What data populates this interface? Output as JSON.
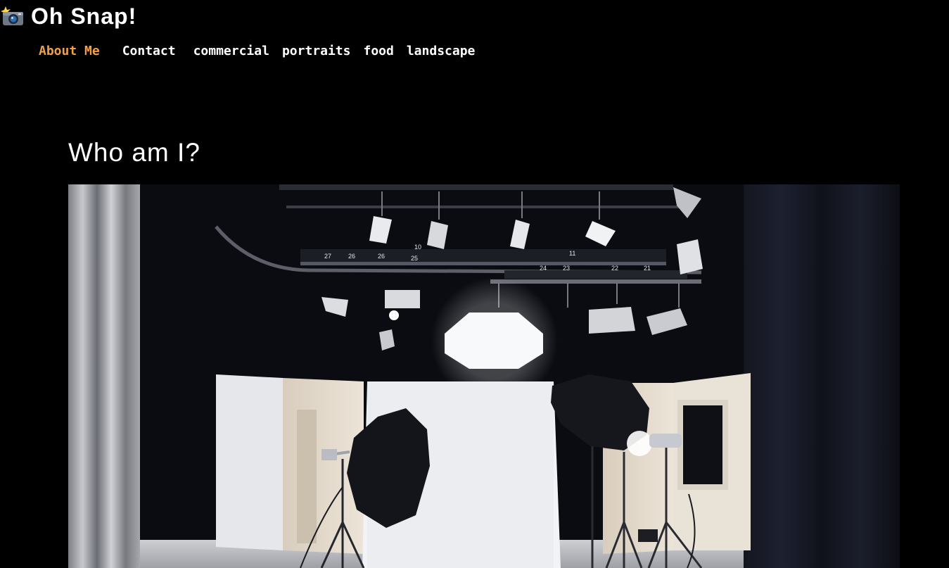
{
  "header": {
    "title": "Oh Snap!",
    "logo_icon": "camera-flash-icon"
  },
  "nav": {
    "items": [
      {
        "label": "About Me",
        "active": true
      },
      {
        "label": "Contact",
        "active": false
      },
      {
        "label": "commercial",
        "active": false
      },
      {
        "label": "portraits",
        "active": false
      },
      {
        "label": "food",
        "active": false
      },
      {
        "label": "landscape",
        "active": false
      }
    ]
  },
  "main": {
    "heading": "Who am I?",
    "hero_image": {
      "subject": "photo-studio-image",
      "rig_labels": [
        "27",
        "26",
        "26",
        "25",
        "10",
        "11",
        "24",
        "23",
        "22",
        "21"
      ]
    }
  },
  "colors": {
    "background": "#000000",
    "text": "#ffffff",
    "nav_active": "#f0a04b"
  }
}
